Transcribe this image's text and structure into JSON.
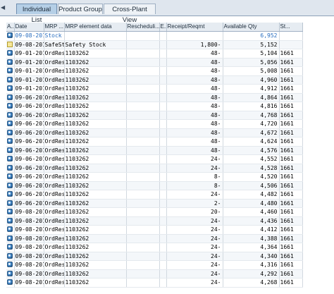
{
  "tabs": [
    {
      "label": "Individual List",
      "active": true
    },
    {
      "label": "Product Group",
      "active": false
    },
    {
      "label": "Cross-Plant View",
      "active": false
    }
  ],
  "columns": [
    "A..",
    "Date",
    "MRP ...",
    "MRP element data",
    "Rescheduli...",
    "E..",
    "Receipt/Reqmt",
    "Available Qty",
    "St..."
  ],
  "rows": [
    {
      "icon": "order",
      "date": "09-08-2016",
      "mrp": "Stock",
      "data": "",
      "resch": "",
      "e": "",
      "receipt": "",
      "avail": "6,952",
      "st": "",
      "blue": true
    },
    {
      "icon": "note",
      "date": "09-08-2016",
      "mrp": "SafeSt",
      "data": "Safety Stock",
      "resch": "",
      "e": "",
      "receipt": "1,800-",
      "avail": "5,152",
      "st": ""
    },
    {
      "icon": "order",
      "date": "09-01-2016",
      "mrp": "OrdRes",
      "data": "1103262",
      "resch": "",
      "e": "",
      "receipt": "48-",
      "avail": "5,104",
      "st": "1661"
    },
    {
      "icon": "order",
      "date": "09-01-2016",
      "mrp": "OrdRes",
      "data": "1103262",
      "resch": "",
      "e": "",
      "receipt": "48-",
      "avail": "5,056",
      "st": "1661"
    },
    {
      "icon": "order",
      "date": "09-01-2016",
      "mrp": "OrdRes",
      "data": "1103262",
      "resch": "",
      "e": "",
      "receipt": "48-",
      "avail": "5,008",
      "st": "1661"
    },
    {
      "icon": "order",
      "date": "09-01-2016",
      "mrp": "OrdRes",
      "data": "1103262",
      "resch": "",
      "e": "",
      "receipt": "48-",
      "avail": "4,960",
      "st": "1661"
    },
    {
      "icon": "order",
      "date": "09-01-2016",
      "mrp": "OrdRes",
      "data": "1103262",
      "resch": "",
      "e": "",
      "receipt": "48-",
      "avail": "4,912",
      "st": "1661"
    },
    {
      "icon": "order",
      "date": "09-06-2016",
      "mrp": "OrdRes",
      "data": "1103262",
      "resch": "",
      "e": "",
      "receipt": "48-",
      "avail": "4,864",
      "st": "1661"
    },
    {
      "icon": "order",
      "date": "09-06-2016",
      "mrp": "OrdRes",
      "data": "1103262",
      "resch": "",
      "e": "",
      "receipt": "48-",
      "avail": "4,816",
      "st": "1661"
    },
    {
      "icon": "order",
      "date": "09-06-2016",
      "mrp": "OrdRes",
      "data": "1103262",
      "resch": "",
      "e": "",
      "receipt": "48-",
      "avail": "4,768",
      "st": "1661"
    },
    {
      "icon": "order",
      "date": "09-06-2016",
      "mrp": "OrdRes",
      "data": "1103262",
      "resch": "",
      "e": "",
      "receipt": "48-",
      "avail": "4,720",
      "st": "1661"
    },
    {
      "icon": "order",
      "date": "09-06-2016",
      "mrp": "OrdRes",
      "data": "1103262",
      "resch": "",
      "e": "",
      "receipt": "48-",
      "avail": "4,672",
      "st": "1661"
    },
    {
      "icon": "order",
      "date": "09-06-2016",
      "mrp": "OrdRes",
      "data": "1103262",
      "resch": "",
      "e": "",
      "receipt": "48-",
      "avail": "4,624",
      "st": "1661"
    },
    {
      "icon": "order",
      "date": "09-06-2016",
      "mrp": "OrdRes",
      "data": "1103262",
      "resch": "",
      "e": "",
      "receipt": "48-",
      "avail": "4,576",
      "st": "1661"
    },
    {
      "icon": "order",
      "date": "09-06-2016",
      "mrp": "OrdRes",
      "data": "1103262",
      "resch": "",
      "e": "",
      "receipt": "24-",
      "avail": "4,552",
      "st": "1661"
    },
    {
      "icon": "order",
      "date": "09-06-2016",
      "mrp": "OrdRes",
      "data": "1103262",
      "resch": "",
      "e": "",
      "receipt": "24-",
      "avail": "4,528",
      "st": "1661"
    },
    {
      "icon": "order",
      "date": "09-06-2016",
      "mrp": "OrdRes",
      "data": "1103262",
      "resch": "",
      "e": "",
      "receipt": "8-",
      "avail": "4,520",
      "st": "1661"
    },
    {
      "icon": "order",
      "date": "09-06-2016",
      "mrp": "OrdRes",
      "data": "1103262",
      "resch": "",
      "e": "",
      "receipt": "8-",
      "avail": "4,506",
      "st": "1661"
    },
    {
      "icon": "order",
      "date": "09-06-2016",
      "mrp": "OrdRes",
      "data": "1103262",
      "resch": "",
      "e": "",
      "receipt": "24-",
      "avail": "4,482",
      "st": "1661"
    },
    {
      "icon": "order",
      "date": "09-06-2016",
      "mrp": "OrdRes",
      "data": "1103262",
      "resch": "",
      "e": "",
      "receipt": "2-",
      "avail": "4,480",
      "st": "1661"
    },
    {
      "icon": "order",
      "date": "09-08-2016",
      "mrp": "OrdRes",
      "data": "1103262",
      "resch": "",
      "e": "",
      "receipt": "20-",
      "avail": "4,460",
      "st": "1661"
    },
    {
      "icon": "order",
      "date": "09-08-2016",
      "mrp": "OrdRes",
      "data": "1103262",
      "resch": "",
      "e": "",
      "receipt": "24-",
      "avail": "4,436",
      "st": "1661"
    },
    {
      "icon": "order",
      "date": "09-08-2016",
      "mrp": "OrdRes",
      "data": "1103262",
      "resch": "",
      "e": "",
      "receipt": "24-",
      "avail": "4,412",
      "st": "1661"
    },
    {
      "icon": "order",
      "date": "09-08-2016",
      "mrp": "OrdRes",
      "data": "1103262",
      "resch": "",
      "e": "",
      "receipt": "24-",
      "avail": "4,388",
      "st": "1661"
    },
    {
      "icon": "order",
      "date": "09-08-2016",
      "mrp": "OrdRes",
      "data": "1103262",
      "resch": "",
      "e": "",
      "receipt": "24-",
      "avail": "4,364",
      "st": "1661"
    },
    {
      "icon": "order",
      "date": "09-08-2016",
      "mrp": "OrdRes",
      "data": "1103262",
      "resch": "",
      "e": "",
      "receipt": "24-",
      "avail": "4,340",
      "st": "1661"
    },
    {
      "icon": "order",
      "date": "09-08-2016",
      "mrp": "OrdRes",
      "data": "1103262",
      "resch": "",
      "e": "",
      "receipt": "24-",
      "avail": "4,316",
      "st": "1661"
    },
    {
      "icon": "order",
      "date": "09-08-2016",
      "mrp": "OrdRes",
      "data": "1103262",
      "resch": "",
      "e": "",
      "receipt": "24-",
      "avail": "4,292",
      "st": "1661"
    },
    {
      "icon": "order",
      "date": "09-08-2016",
      "mrp": "OrdRes",
      "data": "1103262",
      "resch": "",
      "e": "",
      "receipt": "24-",
      "avail": "4,268",
      "st": "1661"
    }
  ]
}
